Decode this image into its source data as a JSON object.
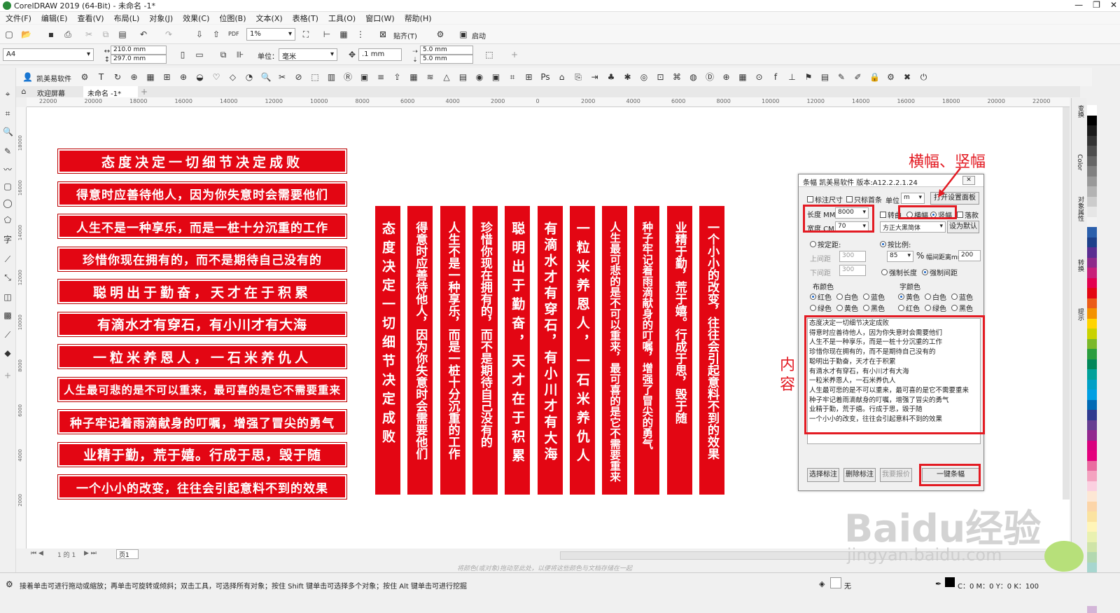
{
  "app": {
    "title": "CorelDRAW 2019 (64-Bit) - 未命名 -1*",
    "window_buttons": [
      "—",
      "❐",
      "✕"
    ]
  },
  "menu": [
    "文件(F)",
    "编辑(E)",
    "查看(V)",
    "布局(L)",
    "对象(J)",
    "效果(C)",
    "位图(B)",
    "文本(X)",
    "表格(T)",
    "工具(O)",
    "窗口(W)",
    "帮助(H)"
  ],
  "toolbar1": {
    "zoom": "1%",
    "snap_label": "贴齐(T)",
    "launch_label": "启动"
  },
  "toolbar2": {
    "page_size": "A4",
    "width": "210.0 mm",
    "height": "297.0 mm",
    "unit_label": "单位：",
    "unit_value": "毫米",
    "nudge": ".1 mm",
    "dup_x": "5.0 mm",
    "dup_y": "5.0 mm"
  },
  "toolbar3": {
    "plugin_name": "凯美易软件"
  },
  "tabs": [
    {
      "label": "欢迎屏幕",
      "active": false
    },
    {
      "label": "未命名 -1*",
      "active": true
    }
  ],
  "ruler_top": [
    "22000",
    "20000",
    "18000",
    "16000",
    "14000",
    "12000",
    "10000",
    "8000",
    "6000",
    "4000",
    "2000",
    "0",
    "2000",
    "4000",
    "6000",
    "8000",
    "10000",
    "12000",
    "14000",
    "16000",
    "18000",
    "20000",
    "22000"
  ],
  "ruler_left": [
    "18000",
    "16000",
    "14000",
    "12000",
    "10000",
    "8000",
    "6000",
    "4000",
    "2000"
  ],
  "banners": {
    "color": "#e30613",
    "text_color": "#ffffff",
    "horizontal": [
      "态度决定一切细节决定成败",
      "得意时应善待他人，因为你失意时会需要他们",
      "人生不是一种享乐，而是一桩十分沉重的工作",
      "珍惜你现在拥有的，而不是期待自己没有的",
      "聪明出于勤奋，天才在于积累",
      "有滴水才有穿石，有小川才有大海",
      "一粒米养恩人，一石米养仇人",
      "人生最可悲的是不可以重来，最可喜的是它不需要重来",
      "种子牢记着雨滴献身的叮嘱，增强了冒尖的勇气",
      "业精于勤，荒于嬉。行成于思，毁于随",
      "一个小小的改变，往往会引起意料不到的效果"
    ],
    "vertical": [
      "态度决定一切细节决定成败",
      "得意时应善待他人，因为你失意时会需要他们",
      "人生不是一种享乐，而是一桩十分沉重的工作",
      "珍惜你现在拥有的，而不是期待自己没有的",
      "聪明出于勤奋，天才在于积累",
      "有滴水才有穿石，有小川才有大海",
      "一粒米养恩人，一石米养仇人",
      "人生最可悲的是不可以重来，最可喜的是它不需要重来",
      "种子牢记着雨滴献身的叮嘱，增强了冒尖的勇气",
      "业精于勤，荒于嬉。行成于思，毁于随",
      "一个小小的改变，往往会引起意料不到的效果"
    ]
  },
  "dialog": {
    "title": "条幅  凯美易软件 版本:A12.2.2.1.24",
    "close": "✕",
    "mark_size": "标注尺寸",
    "first_only": "只标首条",
    "unit_label": "单位",
    "unit_value": "m",
    "open_panel": "打开设置面板",
    "length_label": "长度 MM",
    "length_value": "8000",
    "width_label": "宽度 CM",
    "width_value": "70",
    "rotate": "转曲",
    "horizontal": "横幅",
    "vertical": "竖幅",
    "seal": "落款",
    "font_value": "方正大黑简体",
    "set_default": "设为默认",
    "fixed_spacing": "按定距:",
    "proportional": "按比例:",
    "top_margin_label": "上间距",
    "top_margin_value": "300",
    "bottom_margin_label": "下间距",
    "bottom_margin_value": "300",
    "ratio_value": "85",
    "percent": "%",
    "banner_gap_label": "幅间距离mm",
    "banner_gap_value": "200",
    "force_length": "强制长度",
    "force_gap": "强制间距",
    "cloth_color_label": "布颜色",
    "font_color_label": "字颜色",
    "cloth_colors": [
      "红色",
      "白色",
      "蓝色",
      "绿色",
      "黄色",
      "黑色"
    ],
    "font_colors": [
      "黄色",
      "白色",
      "蓝色",
      "红色",
      "绿色",
      "黑色"
    ],
    "content": "态度决定一切细节决定成败\n得意时应善待他人，因为你失意时会需要他们\n人生不是一种享乐，而是一桩十分沉重的工作\n珍惜你现在拥有的，而不是期待自己没有的\n聪明出于勤奋，天才在于积累\n有滴水才有穿石，有小川才有大海\n一粒米养恩人，一石米养仇人\n人生最可悲的是不可以重来，最可喜的是它不需要重来\n种子牢记着雨滴献身的叮嘱，增强了冒尖的勇气\n业精于勤，荒于嬉。行成于思，毁于随\n一个小小的改变，往往会引起意料不到的效果",
    "btn_select_mark": "选择标注",
    "btn_delete_mark": "删除标注",
    "btn_quote": "我要报价",
    "btn_generate": "一键条幅"
  },
  "annotations": {
    "orientation": "横幅、竖幅",
    "content": "内\n容",
    "color": "#e31b23"
  },
  "pagebar": {
    "page_info": "1 的 1",
    "page_tab": "页1"
  },
  "hint": "将颜色(或对象)拖动至此处，以便将这些颜色与文档存储在一起",
  "status": {
    "message": "接着单击可进行拖动或缩放；再单击可旋转或倾斜；双击工具，可选择所有对象；按住 Shift 键单击可选择多个对象；按住 Alt 键单击可进行挖掘",
    "fill_none": "无",
    "color_readout": "C：0 M：0 Y：0 K：100"
  },
  "dockers": [
    "变换",
    "Color",
    "对象属性",
    "转换",
    "提示"
  ],
  "watermark": {
    "logo": "Baidu经验",
    "url": "jingyan.baidu.com"
  },
  "palette": [
    "#ffffff",
    "#000000",
    "#1a1a1a",
    "#333333",
    "#4d4d4d",
    "#666666",
    "#808080",
    "#999999",
    "#b3b3b3",
    "#cccccc",
    "#e6e6e6",
    "#f2f2f2",
    "#2b5fab",
    "#1d3f8a",
    "#5a2d91",
    "#8e2a8a",
    "#c8207a",
    "#e3004f",
    "#e30613",
    "#eb5b17",
    "#f39200",
    "#ffd400",
    "#c9d200",
    "#7ab829",
    "#2a9d3e",
    "#00875a",
    "#00a19a",
    "#00a0c6",
    "#009fe3",
    "#0069b4",
    "#2f3a8f",
    "#663d91",
    "#93278f",
    "#d9007e",
    "#e5007d",
    "#ea6ba0",
    "#f4a3c0",
    "#fbd0e0",
    "#fde7d4",
    "#fcd5a8",
    "#fbe3a0",
    "#fff5b8",
    "#e9f1b0",
    "#cfe4a8",
    "#b2d8b0",
    "#a7d6cf",
    "#a6d5ec",
    "#a9c5e8",
    "#b8b3da",
    "#d3b5d8"
  ]
}
